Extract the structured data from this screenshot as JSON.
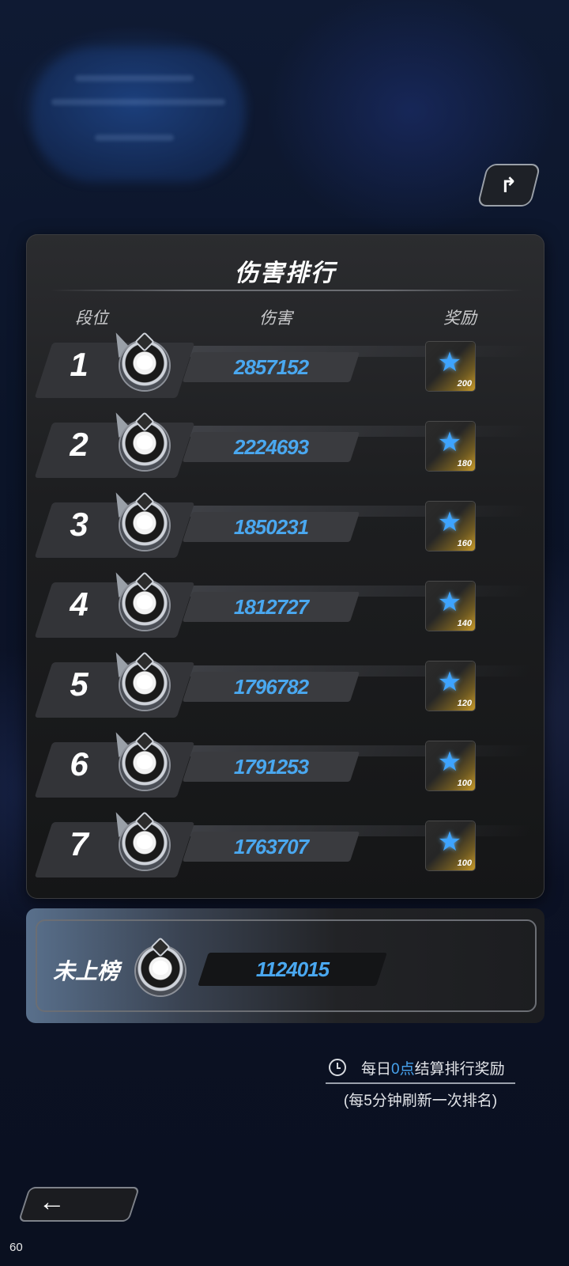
{
  "header": {
    "share_icon": "share-arrow-icon"
  },
  "panel": {
    "title": "伤害排行",
    "columns": {
      "rank": "段位",
      "damage": "伤害",
      "reward": "奖励"
    }
  },
  "rows": [
    {
      "rank": "1",
      "damage": "2857152",
      "reward": "200"
    },
    {
      "rank": "2",
      "damage": "2224693",
      "reward": "180"
    },
    {
      "rank": "3",
      "damage": "1850231",
      "reward": "160"
    },
    {
      "rank": "4",
      "damage": "1812727",
      "reward": "140"
    },
    {
      "rank": "5",
      "damage": "1796782",
      "reward": "120"
    },
    {
      "rank": "6",
      "damage": "1791253",
      "reward": "100"
    },
    {
      "rank": "7",
      "damage": "1763707",
      "reward": "100"
    }
  ],
  "self": {
    "label": "未上榜",
    "damage": "1124015"
  },
  "footer": {
    "reset_prefix": "每日",
    "reset_highlight": "0点",
    "reset_suffix": "结算排行奖励",
    "refresh_note": "(每5分钟刷新一次排名)"
  },
  "fps": "60",
  "colors": {
    "damage_text": "#4aa8f0",
    "highlight": "#47a3ee",
    "star": "#3ea4ff"
  }
}
